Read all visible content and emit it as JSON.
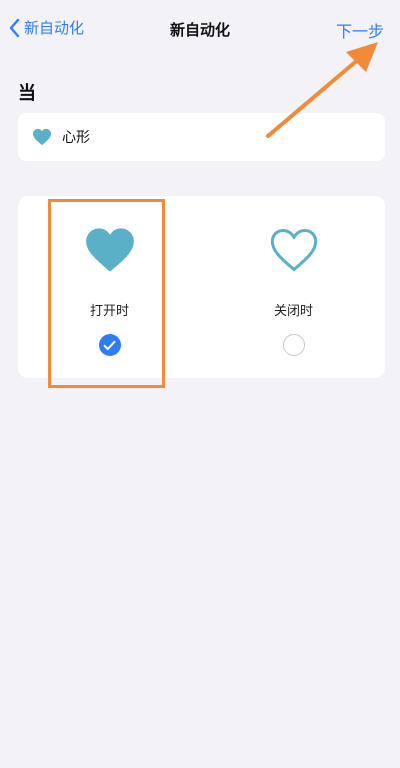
{
  "nav": {
    "back_label": "新自动化",
    "title": "新自动化",
    "next_label": "下一步"
  },
  "section": {
    "when_label": "当"
  },
  "trigger": {
    "icon": "heart-icon",
    "label": "心形"
  },
  "options": [
    {
      "label": "打开时",
      "icon": "filled-heart-icon",
      "selected": true
    },
    {
      "label": "关闭时",
      "icon": "outline-heart-icon",
      "selected": false
    }
  ],
  "colors": {
    "accent": "#2f7cf6",
    "heart": "#5ab1c7",
    "annotation": "#f28a3a",
    "background": "#f2f2f7"
  }
}
